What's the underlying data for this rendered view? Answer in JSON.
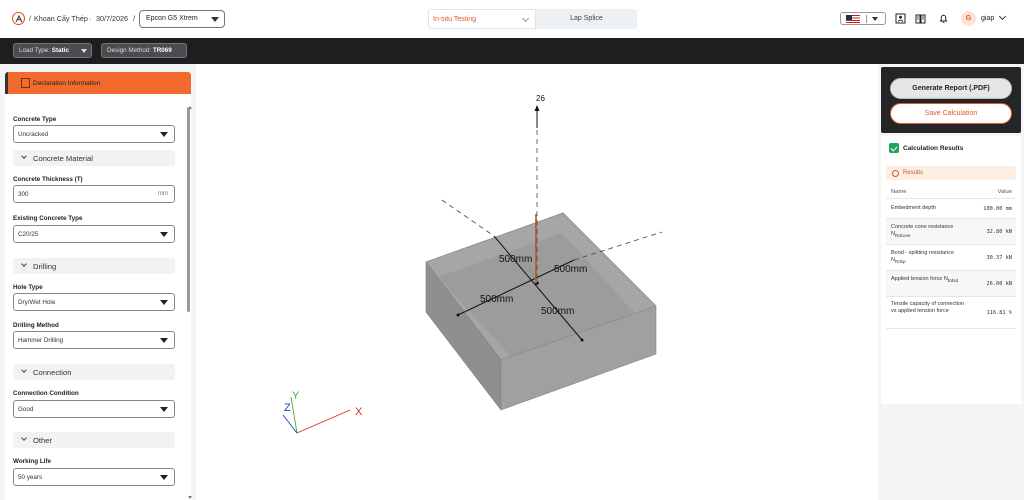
{
  "header": {
    "breadcrumb_project": "Khoan Cấy Thép",
    "breadcrumb_date": "30/7/2026",
    "product": "Epcon G5 Xtrem",
    "tabs": [
      {
        "label": "In-situ Testing"
      },
      {
        "label": "Lap Splice"
      }
    ],
    "user_initial": "G",
    "user_name": "giap"
  },
  "toolbar": {
    "load_type_label": "Load Type:",
    "load_type_value": "Static",
    "design_method_label": "Design Method:",
    "design_method_value": "TR069"
  },
  "panel": {
    "title": "Declaration Information",
    "fields": {
      "concrete_type": {
        "label": "Concrete Type",
        "value": "Uncracked"
      },
      "thickness": {
        "label": "Concrete Thickness (T)",
        "value": "300",
        "unit": "mm"
      },
      "existing_type": {
        "label": "Existing Concrete Type",
        "value": "C20/25"
      },
      "hole_type": {
        "label": "Hole Type",
        "value": "Dry/Wet Hole"
      },
      "drilling_method": {
        "label": "Drilling Method",
        "value": "Hammer Drilling"
      },
      "connection_condition": {
        "label": "Connection Condition",
        "value": "Good"
      },
      "working_life": {
        "label": "Working Life",
        "value": "50 years"
      }
    },
    "sections": {
      "concrete_material": "Concrete Material",
      "drilling": "Drilling",
      "connection": "Connection",
      "other": "Other"
    }
  },
  "viewer": {
    "rebar_top_label": "26",
    "dim_labels": [
      "500mm",
      "500mm",
      "500mm",
      "500mm"
    ],
    "axes": {
      "x": "X",
      "y": "Y",
      "z": "Z"
    },
    "colors": {
      "x": "#d62c2c",
      "y": "#3cb043",
      "z": "#1f3fbf",
      "block": "#9b9b9b"
    }
  },
  "results": {
    "generate_label": "Generate Report (.PDF)",
    "save_label": "Save Calculation",
    "title": "Calculation Results",
    "subtitle": "Results",
    "col_name": "Name",
    "col_value": "Value",
    "rows": [
      {
        "name": "Embedment depth",
        "sub": "",
        "name2": "",
        "value": "100.00 mm"
      },
      {
        "name": "Concrete cone resistance N",
        "sub": "Rdcone",
        "name2": "",
        "value": "32.80 kN"
      },
      {
        "name": "Bond - splitting resistance N",
        "sub": "Rdsp",
        "name2": "",
        "value": "30.37 kN"
      },
      {
        "name": "Applied tension force N",
        "sub": "Edsd",
        "name2": "",
        "value": "26.00 kN"
      },
      {
        "name": "Tensile capacity of connection vs applied tension force",
        "sub": "",
        "name2": "",
        "value": "116.81 %"
      }
    ]
  },
  "colors": {
    "accent": "#f26a2e",
    "dark": "#1d1e20",
    "success": "#1fa55a"
  }
}
